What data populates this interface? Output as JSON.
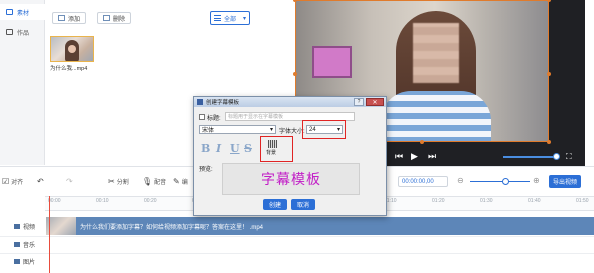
{
  "sidebar": {
    "items": [
      {
        "label": "素材",
        "active": true
      },
      {
        "label": "作品",
        "active": false
      }
    ]
  },
  "library": {
    "add_label": "添加",
    "delete_label": "删除",
    "filter_label": "全部",
    "media_name": "为什么我...mp4"
  },
  "dialog": {
    "title": "创建字幕模板",
    "help_label": "?",
    "close_label": "✕",
    "title_label": "标题:",
    "title_hint": "标题用于显示在字幕模板",
    "font_value": "宋体",
    "size_label": "字体大小:",
    "size_value": "24",
    "bold": "B",
    "italic": "I",
    "underline": "U",
    "strike": "S",
    "bg_label": "背景",
    "preview_label": "预览:",
    "preview_text": "字幕模板",
    "create_label": "创建",
    "cancel_label": "取消"
  },
  "actions": {
    "align_label": "对齐",
    "split_label": "分割",
    "dub_label": "配音",
    "edit_label": "编",
    "time_value": "00:00:00,00",
    "export_label": "导出视频"
  },
  "ruler": [
    "00:00",
    "00:10",
    "00:20",
    "00:30",
    "00:40",
    "00:50",
    "01:00",
    "01:10",
    "01:20",
    "01:30",
    "01:40",
    "01:50"
  ],
  "tracks": [
    {
      "label": "视频"
    },
    {
      "label": "音乐"
    },
    {
      "label": "图片"
    }
  ],
  "clip": {
    "name": "为什么我们要添加字幕？如何给视频添加字幕呢？答案在这里！ .mp4"
  },
  "colors": {
    "accent": "#2c6fd6",
    "highlight": "#e02424",
    "template_text": "#c21ec7",
    "selection": "#e07b2c"
  }
}
